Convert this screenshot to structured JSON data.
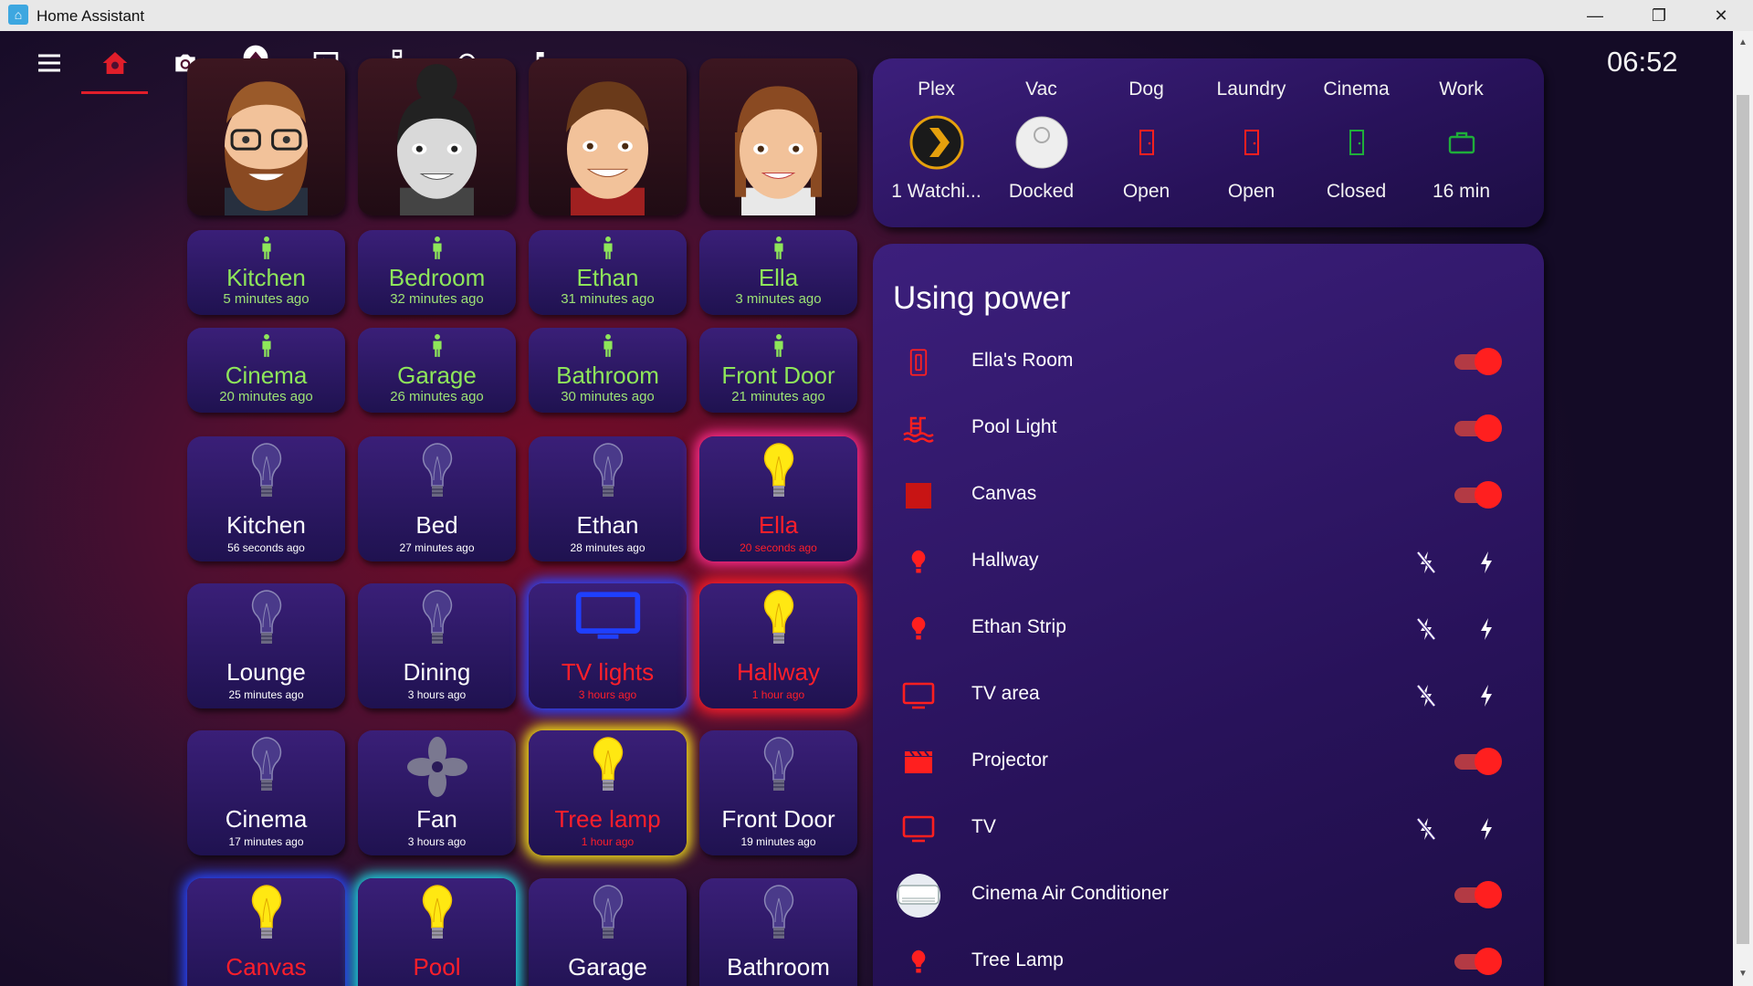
{
  "window": {
    "title": "Home Assistant",
    "controls": [
      "—",
      "❐",
      "✕"
    ]
  },
  "clock": "06:52",
  "toolbar": {
    "icons": [
      "menu-icon",
      "home-icon",
      "camera-icon",
      "eject-icon",
      "media-icon",
      "network-icon",
      "cloud-sync-icon",
      "music-note-icon"
    ],
    "active": "home-icon",
    "accent": "#e01e2a"
  },
  "people": [
    "avatar-man-glasses-beard",
    "avatar-woman-bun",
    "avatar-boy",
    "avatar-girl-braids"
  ],
  "motion_sensors": [
    {
      "name": "Kitchen",
      "time": "5 minutes ago"
    },
    {
      "name": "Bedroom",
      "time": "32 minutes ago"
    },
    {
      "name": "Ethan",
      "time": "31 minutes ago"
    },
    {
      "name": "Ella",
      "time": "3 minutes ago"
    },
    {
      "name": "Cinema",
      "time": "20 minutes ago"
    },
    {
      "name": "Garage",
      "time": "26 minutes ago"
    },
    {
      "name": "Bathroom",
      "time": "30 minutes ago"
    },
    {
      "name": "Front Door",
      "time": "21 minutes ago"
    }
  ],
  "lights": [
    {
      "name": "Kitchen",
      "time": "56 seconds ago",
      "state": "off",
      "icon": "bulb-icon"
    },
    {
      "name": "Bed",
      "time": "27 minutes ago",
      "state": "off",
      "icon": "bulb-icon"
    },
    {
      "name": "Ethan",
      "time": "28 minutes ago",
      "state": "off",
      "icon": "bulb-icon"
    },
    {
      "name": "Ella",
      "time": "20 seconds ago",
      "state": "on",
      "icon": "bulb-icon",
      "glow": "#ff2d8a"
    },
    {
      "name": "Lounge",
      "time": "25 minutes ago",
      "state": "off",
      "icon": "bulb-icon"
    },
    {
      "name": "Dining",
      "time": "3 hours ago",
      "state": "off",
      "icon": "bulb-icon"
    },
    {
      "name": "TV lights",
      "time": "3 hours ago",
      "state": "on",
      "icon": "tv-icon",
      "glow": "#2a48ff"
    },
    {
      "name": "Hallway",
      "time": "1 hour ago",
      "state": "on",
      "icon": "bulb-icon",
      "glow": "#ff1f2a"
    },
    {
      "name": "Cinema",
      "time": "17 minutes ago",
      "state": "off",
      "icon": "bulb-icon"
    },
    {
      "name": "Fan",
      "time": "3 hours ago",
      "state": "off",
      "icon": "fan-icon"
    },
    {
      "name": "Tree lamp",
      "time": "1 hour ago",
      "state": "on",
      "icon": "bulb-icon",
      "glow": "#f6e31a"
    },
    {
      "name": "Front Door",
      "time": "19 minutes ago",
      "state": "off",
      "icon": "bulb-icon"
    },
    {
      "name": "Canvas",
      "time": "",
      "state": "on",
      "icon": "bulb-icon",
      "glow": "#2a48ff"
    },
    {
      "name": "Pool",
      "time": "",
      "state": "on",
      "icon": "bulb-icon",
      "glow": "#1fd8e8"
    },
    {
      "name": "Garage",
      "time": "",
      "state": "off",
      "icon": "bulb-icon"
    },
    {
      "name": "Bathroom",
      "time": "",
      "state": "off",
      "icon": "bulb-icon"
    }
  ],
  "status": [
    {
      "label": "Plex",
      "value": "1 Watchi...",
      "icon": "plex-icon",
      "color": "#e5a00d"
    },
    {
      "label": "Vac",
      "value": "Docked",
      "icon": "robot-vacuum-icon",
      "color": "#eeeeee"
    },
    {
      "label": "Dog",
      "value": "Open",
      "icon": "door-open-icon",
      "color": "#ff1f1f"
    },
    {
      "label": "Laundry",
      "value": "Open",
      "icon": "door-open-icon",
      "color": "#ff1f1f"
    },
    {
      "label": "Cinema",
      "value": "Closed",
      "icon": "door-closed-icon",
      "color": "#1fae3a"
    },
    {
      "label": "Work",
      "value": "16 min",
      "icon": "briefcase-icon",
      "color": "#1fae3a"
    }
  ],
  "power": {
    "title": "Using power",
    "items": [
      {
        "label": "Ella's Room",
        "icon": "switch-icon",
        "control": "toggle",
        "on": true
      },
      {
        "label": "Pool Light",
        "icon": "pool-icon",
        "control": "toggle",
        "on": true
      },
      {
        "label": "Canvas",
        "icon": "square-icon",
        "control": "toggle",
        "on": true
      },
      {
        "label": "Hallway",
        "icon": "lightbulb-icon",
        "control": "buttons"
      },
      {
        "label": "Ethan Strip",
        "icon": "lightbulb-icon",
        "control": "buttons"
      },
      {
        "label": "TV area",
        "icon": "monitor-icon",
        "control": "buttons"
      },
      {
        "label": "Projector",
        "icon": "clapperboard-icon",
        "control": "toggle",
        "on": true
      },
      {
        "label": "TV",
        "icon": "monitor-icon",
        "control": "buttons"
      },
      {
        "label": "Cinema Air Conditioner",
        "icon": "air-conditioner-icon",
        "control": "toggle",
        "on": true
      },
      {
        "label": "Tree Lamp",
        "icon": "lightbulb-icon",
        "control": "toggle",
        "on": true
      }
    ]
  }
}
